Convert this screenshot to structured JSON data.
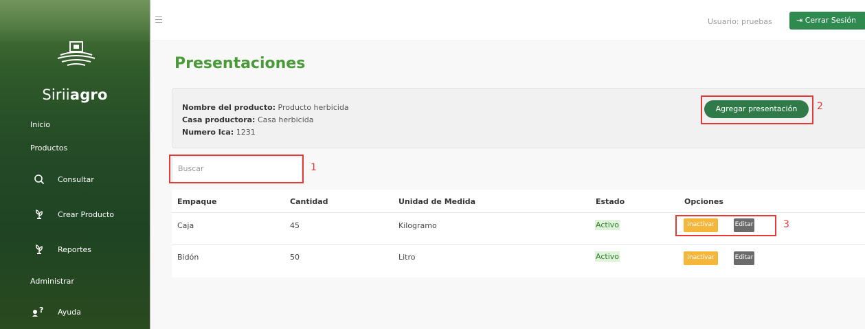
{
  "sidebar": {
    "brand_light": "Sirii",
    "brand_bold": "agro",
    "sections": {
      "inicio": "Inicio",
      "productos": "Productos",
      "administrar": "Administrar"
    },
    "items": [
      {
        "label": "Consultar",
        "icon": "search-icon"
      },
      {
        "label": "Crear Producto",
        "icon": "plant-icon"
      },
      {
        "label": "Reportes",
        "icon": "plant-icon"
      },
      {
        "label": "Ayuda",
        "icon": "help-icon"
      }
    ]
  },
  "topbar": {
    "user_label": "Usuario:",
    "user_name": "pruebas",
    "logout_label": "Cerrar Sesión"
  },
  "page": {
    "title": "Presentaciones"
  },
  "product_info": {
    "name_label": "Nombre del producto:",
    "name_value": "Producto herbicida",
    "maker_label": "Casa productora:",
    "maker_value": "Casa herbicida",
    "ica_label": "Numero Ica:",
    "ica_value": "1231"
  },
  "add_button_label": "Agregar presentación",
  "search": {
    "placeholder": "Buscar"
  },
  "callouts": [
    "1",
    "2",
    "3"
  ],
  "table": {
    "headers": [
      "Empaque",
      "Cantidad",
      "Unidad de Medida",
      "Estado",
      "Opciones"
    ],
    "rows": [
      {
        "empaque": "Caja",
        "cantidad": "45",
        "unidad": "Kilogramo",
        "estado": "Activo",
        "inactivar": "Inactivar",
        "editar": "Editar"
      },
      {
        "empaque": "Bidón",
        "cantidad": "50",
        "unidad": "Litro",
        "estado": "Activo",
        "inactivar": "Inactivar",
        "editar": "Editar"
      }
    ]
  },
  "colors": {
    "brand_green": "#4a9a3a",
    "button_green": "#2f7a48",
    "warning": "#f4b63b",
    "secondary": "#6b6b6b",
    "callout_red": "#e53935"
  }
}
